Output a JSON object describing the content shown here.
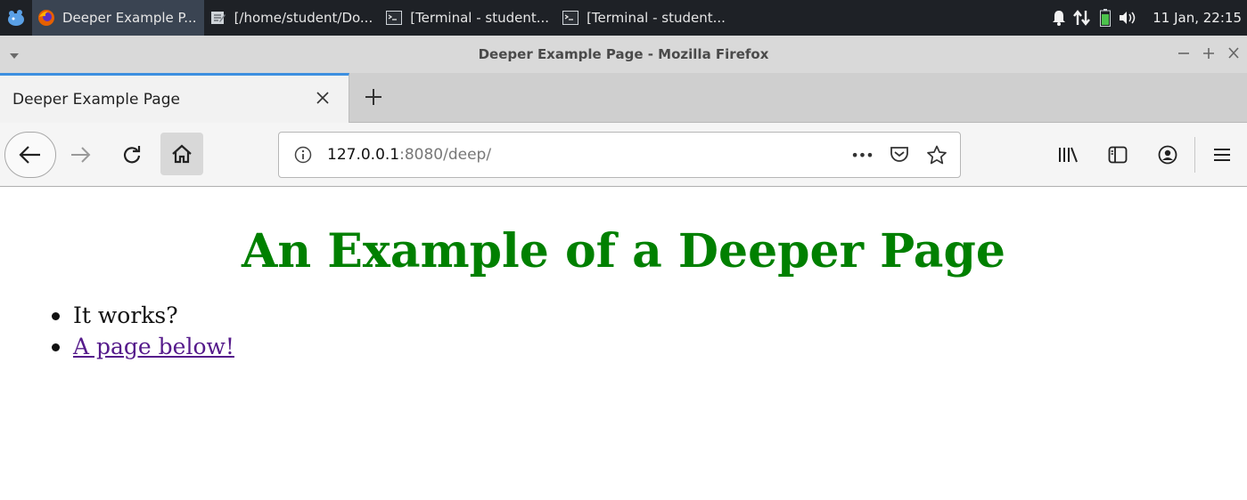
{
  "taskbar": {
    "tasks": [
      {
        "label": "Deeper Example P...",
        "icon": "firefox-icon"
      },
      {
        "label": "[/home/student/Do...",
        "icon": "text-editor-icon"
      },
      {
        "label": "[Terminal - student...",
        "icon": "terminal-icon"
      },
      {
        "label": "[Terminal - student...",
        "icon": "terminal-icon"
      }
    ],
    "clock": "11 Jan, 22:15",
    "colors": {
      "background": "#1e2126",
      "active_task": "#3a4452"
    }
  },
  "window": {
    "title": "Deeper Example Page - Mozilla Firefox"
  },
  "tabs": [
    {
      "label": "Deeper Example Page",
      "active": true
    }
  ],
  "urlbar": {
    "host": "127.0.0.1",
    "rest": ":8080/deep/",
    "actions_label": "•••"
  },
  "page": {
    "heading": "An Example of a Deeper Page",
    "items": [
      {
        "text": "It works?",
        "link": false
      },
      {
        "text": "A page below!",
        "link": true
      }
    ],
    "colors": {
      "heading": "#008000",
      "link_visited": "#551a8b"
    }
  },
  "accent": "#3d8fe0"
}
